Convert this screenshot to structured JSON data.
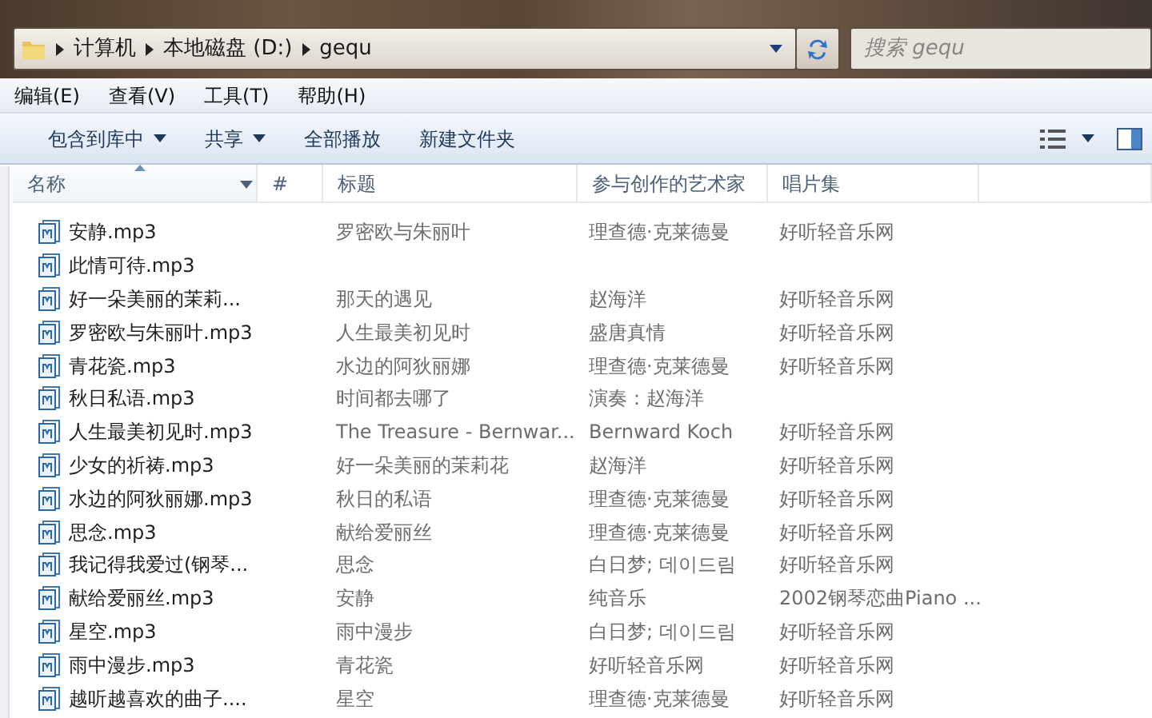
{
  "address_bar": {
    "path": [
      "计算机",
      "本地磁盘 (D:)",
      "gequ"
    ]
  },
  "search": {
    "placeholder": "搜索 gequ"
  },
  "menu": [
    "编辑(E)",
    "查看(V)",
    "工具(T)",
    "帮助(H)"
  ],
  "toolbar": [
    {
      "label": "包含到库中",
      "has_menu": true
    },
    {
      "label": "共享",
      "has_menu": true
    },
    {
      "label": "全部播放",
      "has_menu": false
    },
    {
      "label": "新建文件夹",
      "has_menu": false
    }
  ],
  "table": {
    "columns": [
      {
        "label": "名称",
        "sorted": true
      },
      {
        "label": "#",
        "sorted": false
      },
      {
        "label": "标题",
        "sorted": false
      },
      {
        "label": "参与创作的艺术家",
        "sorted": false
      },
      {
        "label": "唱片集",
        "sorted": false
      }
    ],
    "rows": [
      {
        "name": "安静.mp3",
        "title": "罗密欧与朱丽叶",
        "artist": "理查德·克莱德曼",
        "album": "好听轻音乐网"
      },
      {
        "name": "此情可待.mp3"
      },
      {
        "name": "好一朵美丽的茉莉...",
        "title": "那天的遇见",
        "artist": "赵海洋",
        "album": "好听轻音乐网"
      },
      {
        "name": "罗密欧与朱丽叶.mp3",
        "title": "人生最美初见时",
        "artist": "盛唐真情",
        "album": "好听轻音乐网"
      },
      {
        "name": "青花瓷.mp3",
        "title": "水边的阿狄丽娜",
        "artist": "理查德·克莱德曼",
        "album": "好听轻音乐网"
      },
      {
        "name": "秋日私语.mp3",
        "title": "时间都去哪了",
        "artist": "演奏：赵海洋"
      },
      {
        "name": "人生最美初见时.mp3",
        "title": "The Treasure - Bernwar...",
        "artist": "Bernward Koch",
        "album": "好听轻音乐网"
      },
      {
        "name": "少女的祈祷.mp3",
        "title": "好一朵美丽的茉莉花",
        "artist": "赵海洋",
        "album": "好听轻音乐网"
      },
      {
        "name": "水边的阿狄丽娜.mp3",
        "title": "秋日的私语",
        "artist": "理查德·克莱德曼",
        "album": "好听轻音乐网"
      },
      {
        "name": "思念.mp3",
        "title": "献给爱丽丝",
        "artist": "理查德·克莱德曼",
        "album": "好听轻音乐网"
      },
      {
        "name": "我记得我爱过(钢琴...",
        "title": "思念",
        "artist": "白日梦; 데이드림",
        "album": "好听轻音乐网"
      },
      {
        "name": "献给爱丽丝.mp3",
        "title": "安静",
        "artist": "纯音乐",
        "album": "2002钢琴恋曲Piano ..."
      },
      {
        "name": "星空.mp3",
        "title": "雨中漫步",
        "artist": "白日梦; 데이드림",
        "album": "好听轻音乐网"
      },
      {
        "name": "雨中漫步.mp3",
        "title": "青花瓷",
        "artist": "好听轻音乐网",
        "album": "好听轻音乐网"
      },
      {
        "name": "越听越喜欢的曲子....",
        "title": "星空",
        "artist": "理查德·克莱德曼",
        "album": "好听轻音乐网"
      }
    ]
  }
}
